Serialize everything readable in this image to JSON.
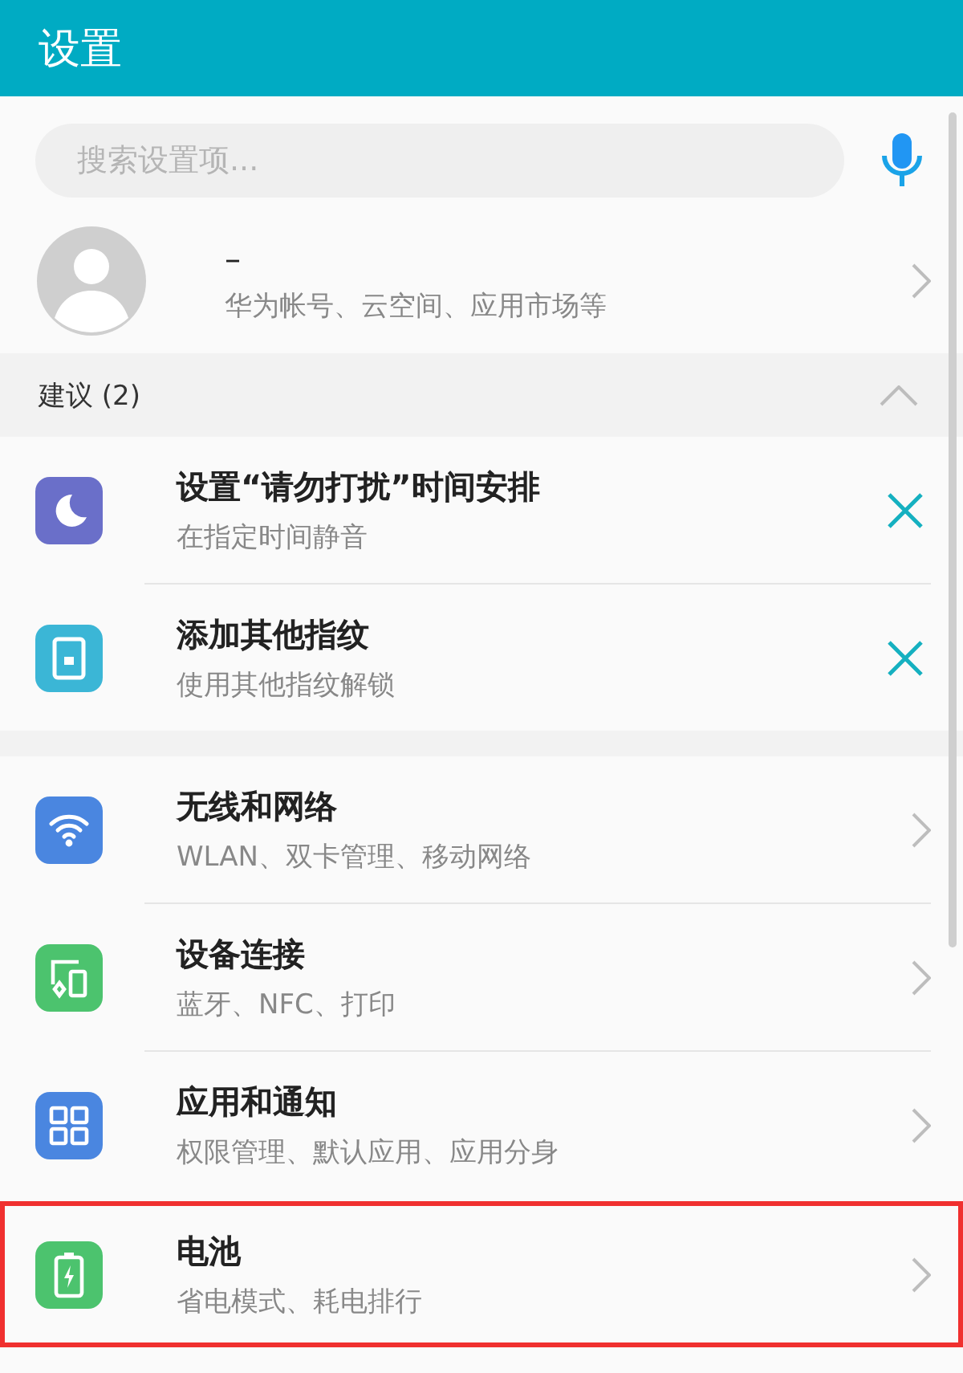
{
  "header": {
    "title": "设置"
  },
  "search": {
    "placeholder": "搜索设置项..."
  },
  "account": {
    "name": "–",
    "subtitle": "华为帐号、云空间、应用市场等"
  },
  "suggestions": {
    "title": "建议 (2)",
    "expanded": true,
    "items": [
      {
        "title": "设置“请勿打扰”时间安排",
        "subtitle": "在指定时间静音",
        "color": "#6a6fc9"
      },
      {
        "title": "添加其他指纹",
        "subtitle": "使用其他指纹解锁",
        "color": "#3bb6d6"
      }
    ]
  },
  "settings": [
    {
      "title": "无线和网络",
      "subtitle": "WLAN、双卡管理、移动网络",
      "color": "#4a86e0",
      "highlighted": false
    },
    {
      "title": "设备连接",
      "subtitle": "蓝牙、NFC、打印",
      "color": "#4cc36e",
      "highlighted": false
    },
    {
      "title": "应用和通知",
      "subtitle": "权限管理、默认应用、应用分身",
      "color": "#4a86e0",
      "highlighted": false
    },
    {
      "title": "电池",
      "subtitle": "省电模式、耗电排行",
      "color": "#4cc36e",
      "highlighted": true
    }
  ]
}
